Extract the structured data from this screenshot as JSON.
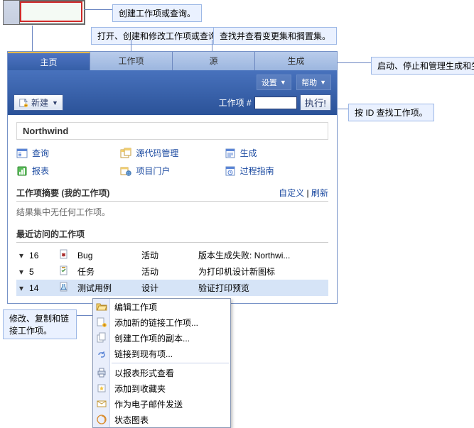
{
  "annotations": {
    "create_wi": "创建工作项或查询。",
    "open_edit": "打开、创建和修改工作项或查询。",
    "find_changes": "查找并查看变更集和搁置集。",
    "manage_builds": "启动、停止和管理生成和生成质量。",
    "find_by_id": "按 ID 查找工作项。",
    "modify_copy": "修改、复制和链接工作项。"
  },
  "tabs": {
    "home": "主页",
    "workitems": "工作项",
    "source": "源",
    "builds": "生成"
  },
  "header": {
    "settings": "设置",
    "help": "帮助",
    "new_btn": "新建",
    "wi_label": "工作项 #",
    "go": "执行!"
  },
  "project": {
    "title": "Northwind"
  },
  "links": {
    "query": "查询",
    "source": "源代码管理",
    "build": "生成",
    "reports": "报表",
    "portal": "项目门户",
    "guide": "过程指南"
  },
  "summary": {
    "title": "工作项摘要 (我的工作项)",
    "customize": "自定义",
    "refresh": "刷新",
    "empty": "结果集中无任何工作项。"
  },
  "recent": {
    "title": "最近访问的工作项",
    "rows": [
      {
        "id": "16",
        "type": "Bug",
        "state": "活动",
        "title": "版本生成失败: Northwi..."
      },
      {
        "id": "5",
        "type": "任务",
        "state": "活动",
        "title": "为打印机设计新图标"
      },
      {
        "id": "14",
        "type": "测试用例",
        "state": "设计",
        "title": "验证打印预览"
      }
    ]
  },
  "ctx": {
    "edit": "编辑工作项",
    "addlink": "添加新的链接工作项...",
    "copy": "创建工作项的副本...",
    "linkexisting": "链接到现有项...",
    "viewreport": "以报表形式查看",
    "fav": "添加到收藏夹",
    "email": "作为电子邮件发送",
    "statechart": "状态图表"
  }
}
